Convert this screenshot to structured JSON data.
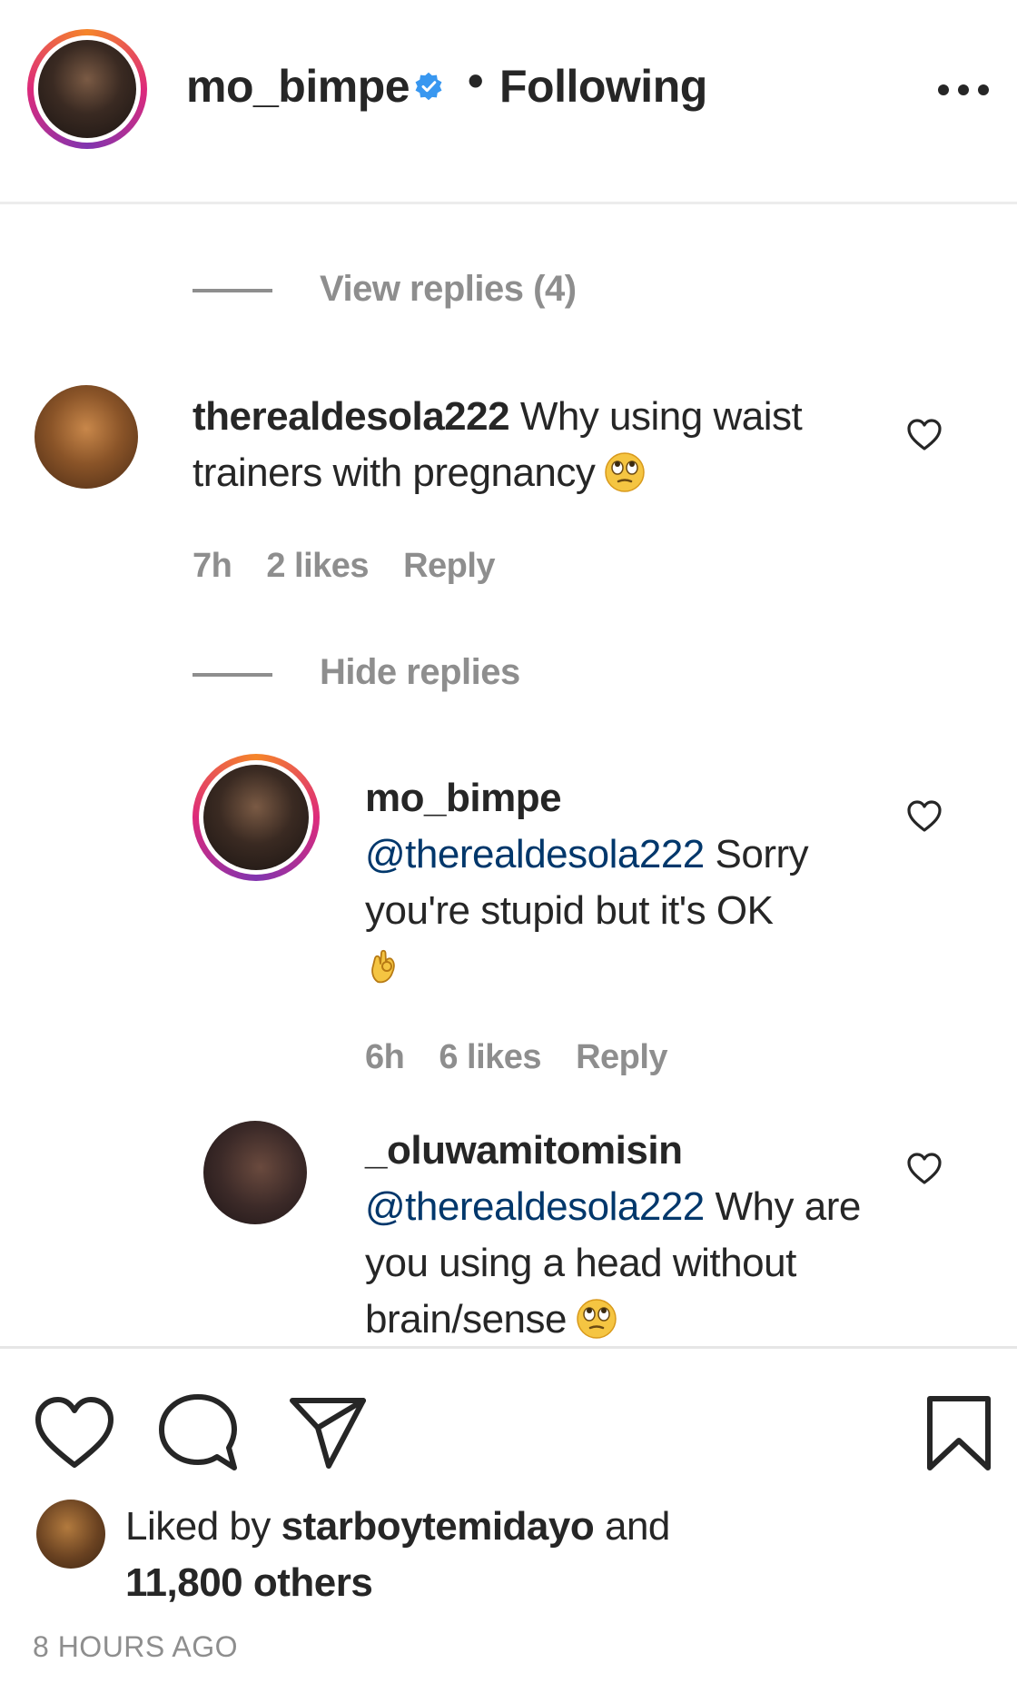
{
  "header": {
    "username": "mo_bimpe",
    "separator": "•",
    "follow_status": "Following",
    "more_icon": "more-horizontal-icon",
    "verified_icon": "verified-badge-icon"
  },
  "thread": {
    "view_replies_label": "View replies (4)",
    "comment": {
      "username": "therealdesola222",
      "text_before_emoji": "Why using waist trainers with pregnancy",
      "emoji": "rolling-eyes-emoji",
      "time": "7h",
      "likes": "2 likes",
      "reply_label": "Reply"
    },
    "hide_replies_label": "Hide replies",
    "replies": [
      {
        "username": "mo_bimpe",
        "mention": "@therealdesola222",
        "text": "Sorry you're stupid but it's OK",
        "emoji": "ok-hand-emoji",
        "time": "6h",
        "likes": "6 likes",
        "reply_label": "Reply"
      },
      {
        "username": "_oluwamitomisin",
        "mention": "@therealdesola222",
        "text": "Why are you using a head without brain/sense",
        "emoji": "rolling-eyes-emoji"
      }
    ]
  },
  "actions": {
    "like_icon": "heart-icon",
    "comment_icon": "comment-bubble-icon",
    "share_icon": "send-paper-plane-icon",
    "save_icon": "bookmark-icon"
  },
  "likes": {
    "prefix": "Liked by",
    "liked_by_user": "starboytemidayo",
    "conjunction": "and",
    "others": "11,800 others"
  },
  "post_time": "8 HOURS AGO",
  "colors": {
    "text_primary": "#262626",
    "text_secondary": "#8e8e8e",
    "mention": "#00376b",
    "verified_blue": "#3897f0"
  }
}
